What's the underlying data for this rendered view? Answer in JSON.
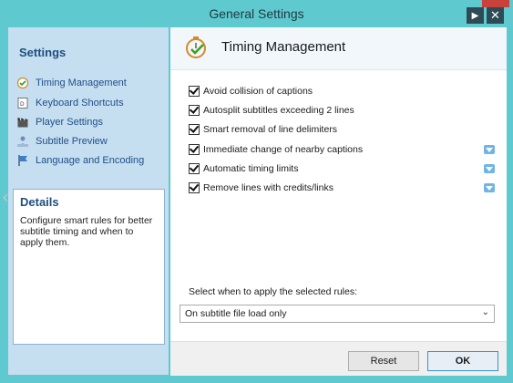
{
  "window": {
    "title": "General Settings"
  },
  "sidebar": {
    "title": "Settings",
    "items": [
      {
        "label": "Timing Management",
        "icon": "clock-check-icon"
      },
      {
        "label": "Keyboard Shortcuts",
        "icon": "keyboard-icon"
      },
      {
        "label": "Player Settings",
        "icon": "clapperboard-icon"
      },
      {
        "label": "Subtitle Preview",
        "icon": "preview-icon"
      },
      {
        "label": "Language and Encoding",
        "icon": "flag-icon"
      }
    ],
    "details": {
      "title": "Details",
      "text": "Configure smart rules for better subtitle timing and when to apply them."
    }
  },
  "main": {
    "title": "Timing Management",
    "options": [
      {
        "label": "Avoid collision of captions",
        "checked": true,
        "has_dropdown": false
      },
      {
        "label": "Autosplit subtitles exceeding 2 lines",
        "checked": true,
        "has_dropdown": false
      },
      {
        "label": "Smart removal of line delimiters",
        "checked": true,
        "has_dropdown": false
      },
      {
        "label": "Immediate change of nearby captions",
        "checked": true,
        "has_dropdown": true
      },
      {
        "label": "Automatic timing limits",
        "checked": true,
        "has_dropdown": true
      },
      {
        "label": "Remove lines with credits/links",
        "checked": true,
        "has_dropdown": true
      }
    ],
    "apply_label": "Select when to apply the selected rules:",
    "apply_select_value": "On subtitle file load only"
  },
  "footer": {
    "reset_label": "Reset",
    "ok_label": "OK"
  },
  "colors": {
    "accent": "#5ec9cf",
    "sidebar_bg": "#c5def0",
    "link": "#1f4f8a",
    "ok_border": "#3c8fd6"
  }
}
